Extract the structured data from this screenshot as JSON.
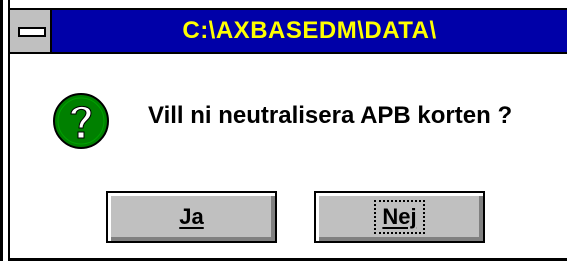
{
  "window": {
    "title": "C:\\AXBASEDM\\DATA\\"
  },
  "message": {
    "text": "Vill ni neutralisera APB korten ?",
    "icon": "question-icon"
  },
  "buttons": {
    "yes_label": "Ja",
    "no_label": "Nej"
  },
  "colors": {
    "titlebar": "#0000a8",
    "title_text": "#ffff00",
    "button_face": "#c0c0c0",
    "icon_green": "#008000"
  }
}
